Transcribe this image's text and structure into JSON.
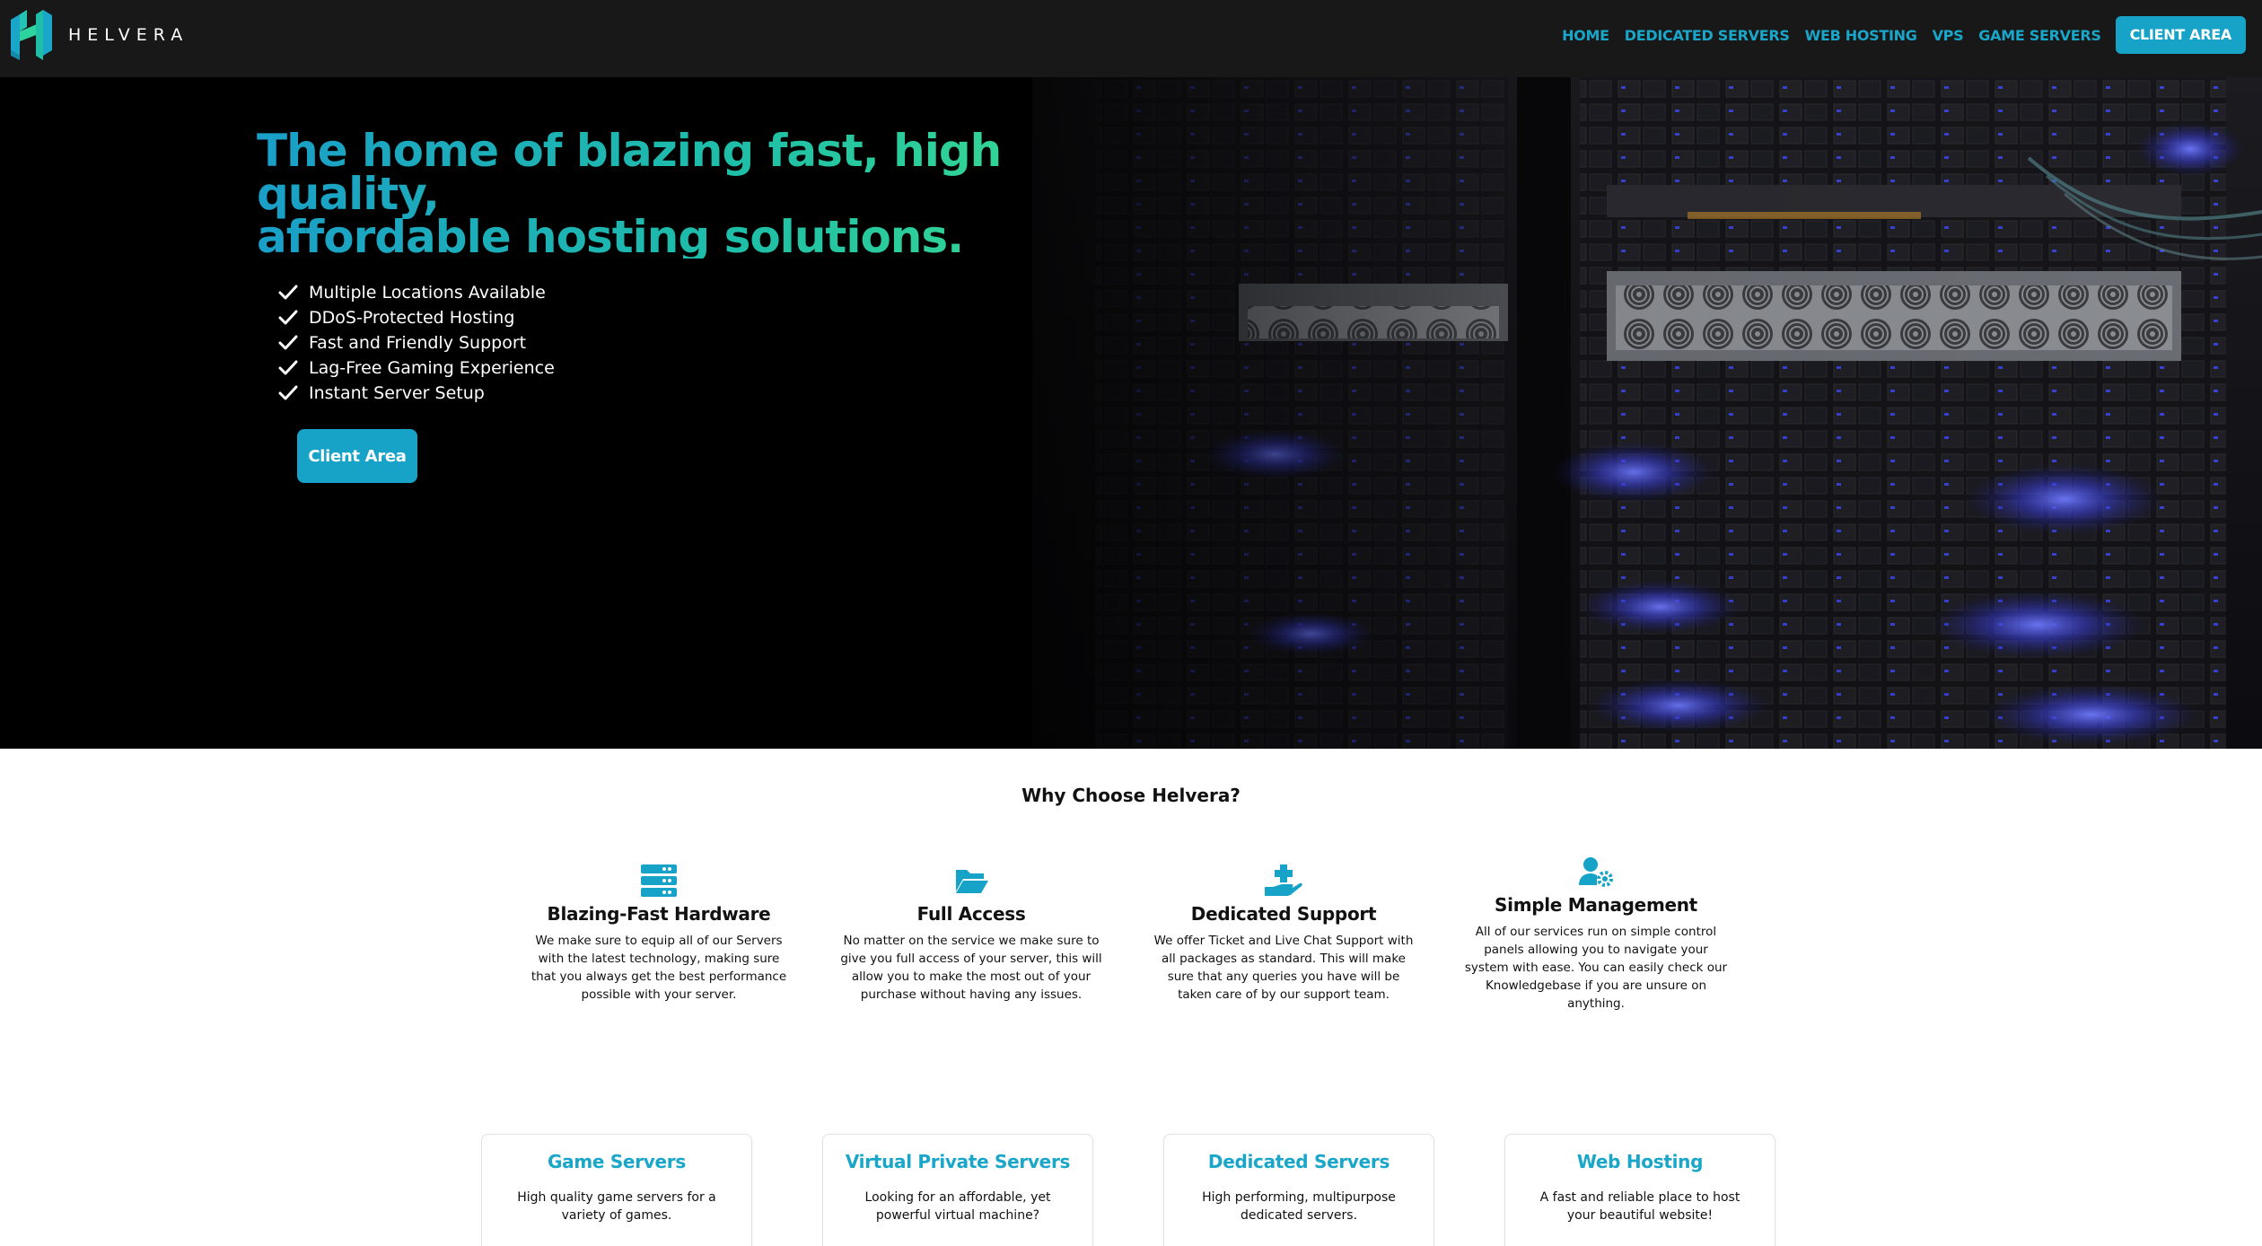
{
  "brand": {
    "name": "HELVERA"
  },
  "nav": {
    "links": [
      "HOME",
      "DEDICATED SERVERS",
      "WEB HOSTING",
      "VPS",
      "GAME SERVERS"
    ],
    "cta": "CLIENT AREA"
  },
  "hero": {
    "title_line1": "The home of blazing fast, high quality,",
    "title_line2": "affordable hosting solutions.",
    "features": [
      "Multiple Locations Available",
      "DDoS-Protected Hosting",
      "Fast and Friendly Support",
      "Lag-Free Gaming Experience",
      "Instant Server Setup"
    ],
    "button": "Client Area"
  },
  "why": {
    "title": "Why Choose Helvera?",
    "items": [
      {
        "icon": "server-icon",
        "heading": "Blazing-Fast Hardware",
        "text": "We make sure to equip all of our Servers with the latest technology, making sure that you always get the best performance possible with your server."
      },
      {
        "icon": "folder-open-icon",
        "heading": "Full Access",
        "text": "No matter on the service we make sure to give you full access of your server, this will allow you to make the most out of your purchase without having any issues."
      },
      {
        "icon": "hand-holding-medical-icon",
        "heading": "Dedicated Support",
        "text": "We offer Ticket and Live Chat Support with all packages as standard. This will make sure that any queries you have will be taken care of by our support team."
      },
      {
        "icon": "user-cog-icon",
        "heading": "Simple Management",
        "text": "All of our services run on simple control panels allowing you to navigate your system with ease. You can easily check our Knowledgebase if you are unsure on anything."
      }
    ]
  },
  "services": [
    {
      "title": "Game Servers",
      "text": "High quality game servers for a variety of games."
    },
    {
      "title": "Virtual Private Servers",
      "text": "Looking for an affordable, yet powerful virtual machine?"
    },
    {
      "title": "Dedicated Servers",
      "text": "High performing, multipurpose dedicated servers."
    },
    {
      "title": "Web Hosting",
      "text": "A fast and reliable place to host your beautiful website!"
    }
  ],
  "colors": {
    "accent": "#17a3c8",
    "nav_bg": "#181818",
    "hero_gradient_start": "#1a9fc8",
    "hero_gradient_end": "#3fe28a"
  }
}
